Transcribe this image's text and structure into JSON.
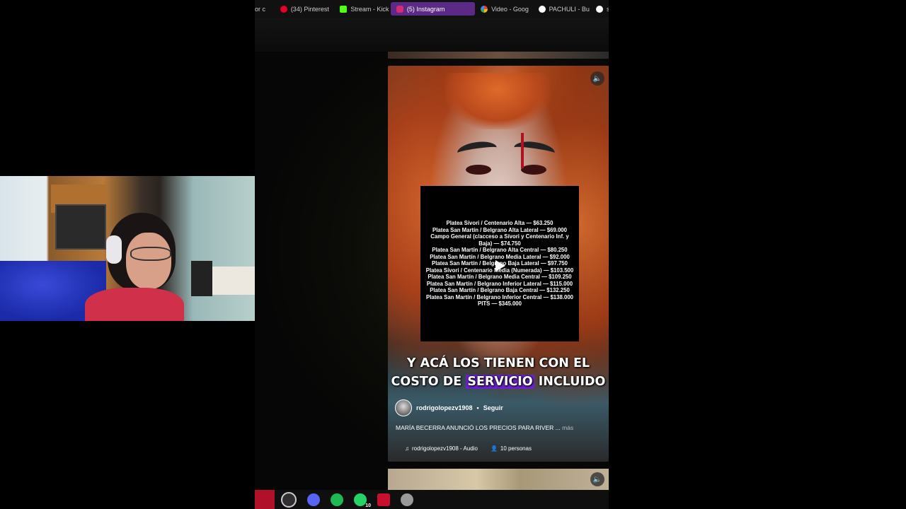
{
  "browser": {
    "tabs": [
      {
        "label": "or c",
        "color": "#444444"
      },
      {
        "label": "(34) Pinterest",
        "color": "#e60023"
      },
      {
        "label": "Stream - Kick",
        "color": "#53fc18"
      },
      {
        "label": "(5) Instagram",
        "color": "#d62976",
        "active": true
      },
      {
        "label": "Video - Goog",
        "color": "#f4b400"
      },
      {
        "label": "PACHULI - Bu",
        "color": "#ffffff"
      },
      {
        "label": "s",
        "color": "#ffffff"
      }
    ]
  },
  "reel": {
    "prices": [
      "Platea Sívori / Centenario Alta — $63.250",
      "Platea San Martín / Belgrano Alta Lateral — $69.000",
      "Campo General (c/acceso a Sívori y Centenario Inf. y Baja) — $74.750",
      "Platea San Martín / Belgrano Alta Central — $80.250",
      "Platea San Martín / Belgrano Media Lateral — $92.000",
      "Platea San Martín / Belgrano Baja Lateral — $97.750",
      "Platea Sívori / Centenario Media (Numerada) — $103.500",
      "Platea San Martín / Belgrano Media Central — $109.250",
      "Platea San Martín / Belgrano Inferior Lateral — $115.000",
      "Platea San Martín / Belgrano Baja Central — $132.250",
      "Platea San Martín / Belgrano Inferior Central — $138.000",
      "PITS — $345.000"
    ],
    "caption_line1": "Y ACÁ LOS TIENEN CON EL",
    "caption_pre": "COSTO DE",
    "caption_highlight": "SERVICIO",
    "caption_post": "INCLUIDO",
    "author": "rodrigolopezv1908",
    "dot": "•",
    "follow": "Seguir",
    "description": "MARÍA BECERRA ANUNCIÓ LOS PRECIOS PARA RIVER ...",
    "more": "más",
    "audio": "rodrigolopezv1908 - Audio",
    "people": "10 personas",
    "icons": {
      "sound": "speaker-icon",
      "music": "music-note-icon",
      "people": "person-icon",
      "play": "play-icon"
    },
    "highlight_color": "#6a23c8"
  },
  "taskbar": {
    "items": [
      {
        "name": "obs-icon",
        "color": "#302e31"
      },
      {
        "name": "discord-icon",
        "color": "#5865f2"
      },
      {
        "name": "spotify-icon",
        "color": "#1db954"
      },
      {
        "name": "whatsapp-icon",
        "color": "#25d366",
        "badge": "10"
      },
      {
        "name": "app-red-icon",
        "color": "#c8102e"
      },
      {
        "name": "app-grey-icon",
        "color": "#9a9a9a"
      }
    ]
  }
}
